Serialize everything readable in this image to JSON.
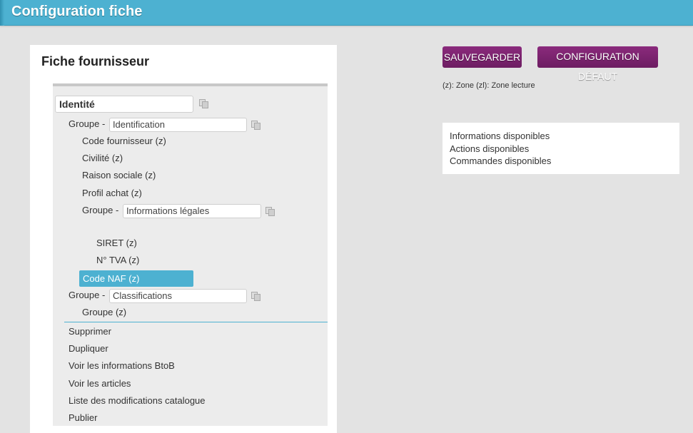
{
  "header": {
    "title": "Configuration fiche"
  },
  "panel": {
    "title": "Fiche fournisseur",
    "section": {
      "value": "Identité"
    },
    "group_prefix": "Groupe -",
    "groups": [
      {
        "value": "Identification"
      },
      {
        "value": "Informations légales"
      },
      {
        "value": "Classifications"
      }
    ],
    "fields": {
      "code_fournisseur": "Code fournisseur (z)",
      "civilite": "Civilité (z)",
      "raison_sociale": "Raison sociale (z)",
      "profil_achat": "Profil achat (z)",
      "siret": "SIRET (z)",
      "tva": "N° TVA (z)",
      "code_naf": "Code NAF (z)",
      "groupe_z": "Groupe (z)"
    },
    "actions": [
      "Supprimer",
      "Dupliquer",
      "Voir les informations BtoB",
      "Voir les articles",
      "Liste des modifications catalogue",
      "Publier"
    ]
  },
  "toolbar": {
    "save_label": "SAUVEGARDER",
    "default_config_label": "CONFIGURATION DÉFAUT"
  },
  "legend_note": "(z): Zone (zl): Zone lecture",
  "available": [
    "Informations disponibles",
    "Actions disponibles",
    "Commandes disponibles"
  ],
  "colors": {
    "header": "#4db1d1",
    "accent_button": "#7a2470",
    "selected_row": "#4db1d1"
  }
}
